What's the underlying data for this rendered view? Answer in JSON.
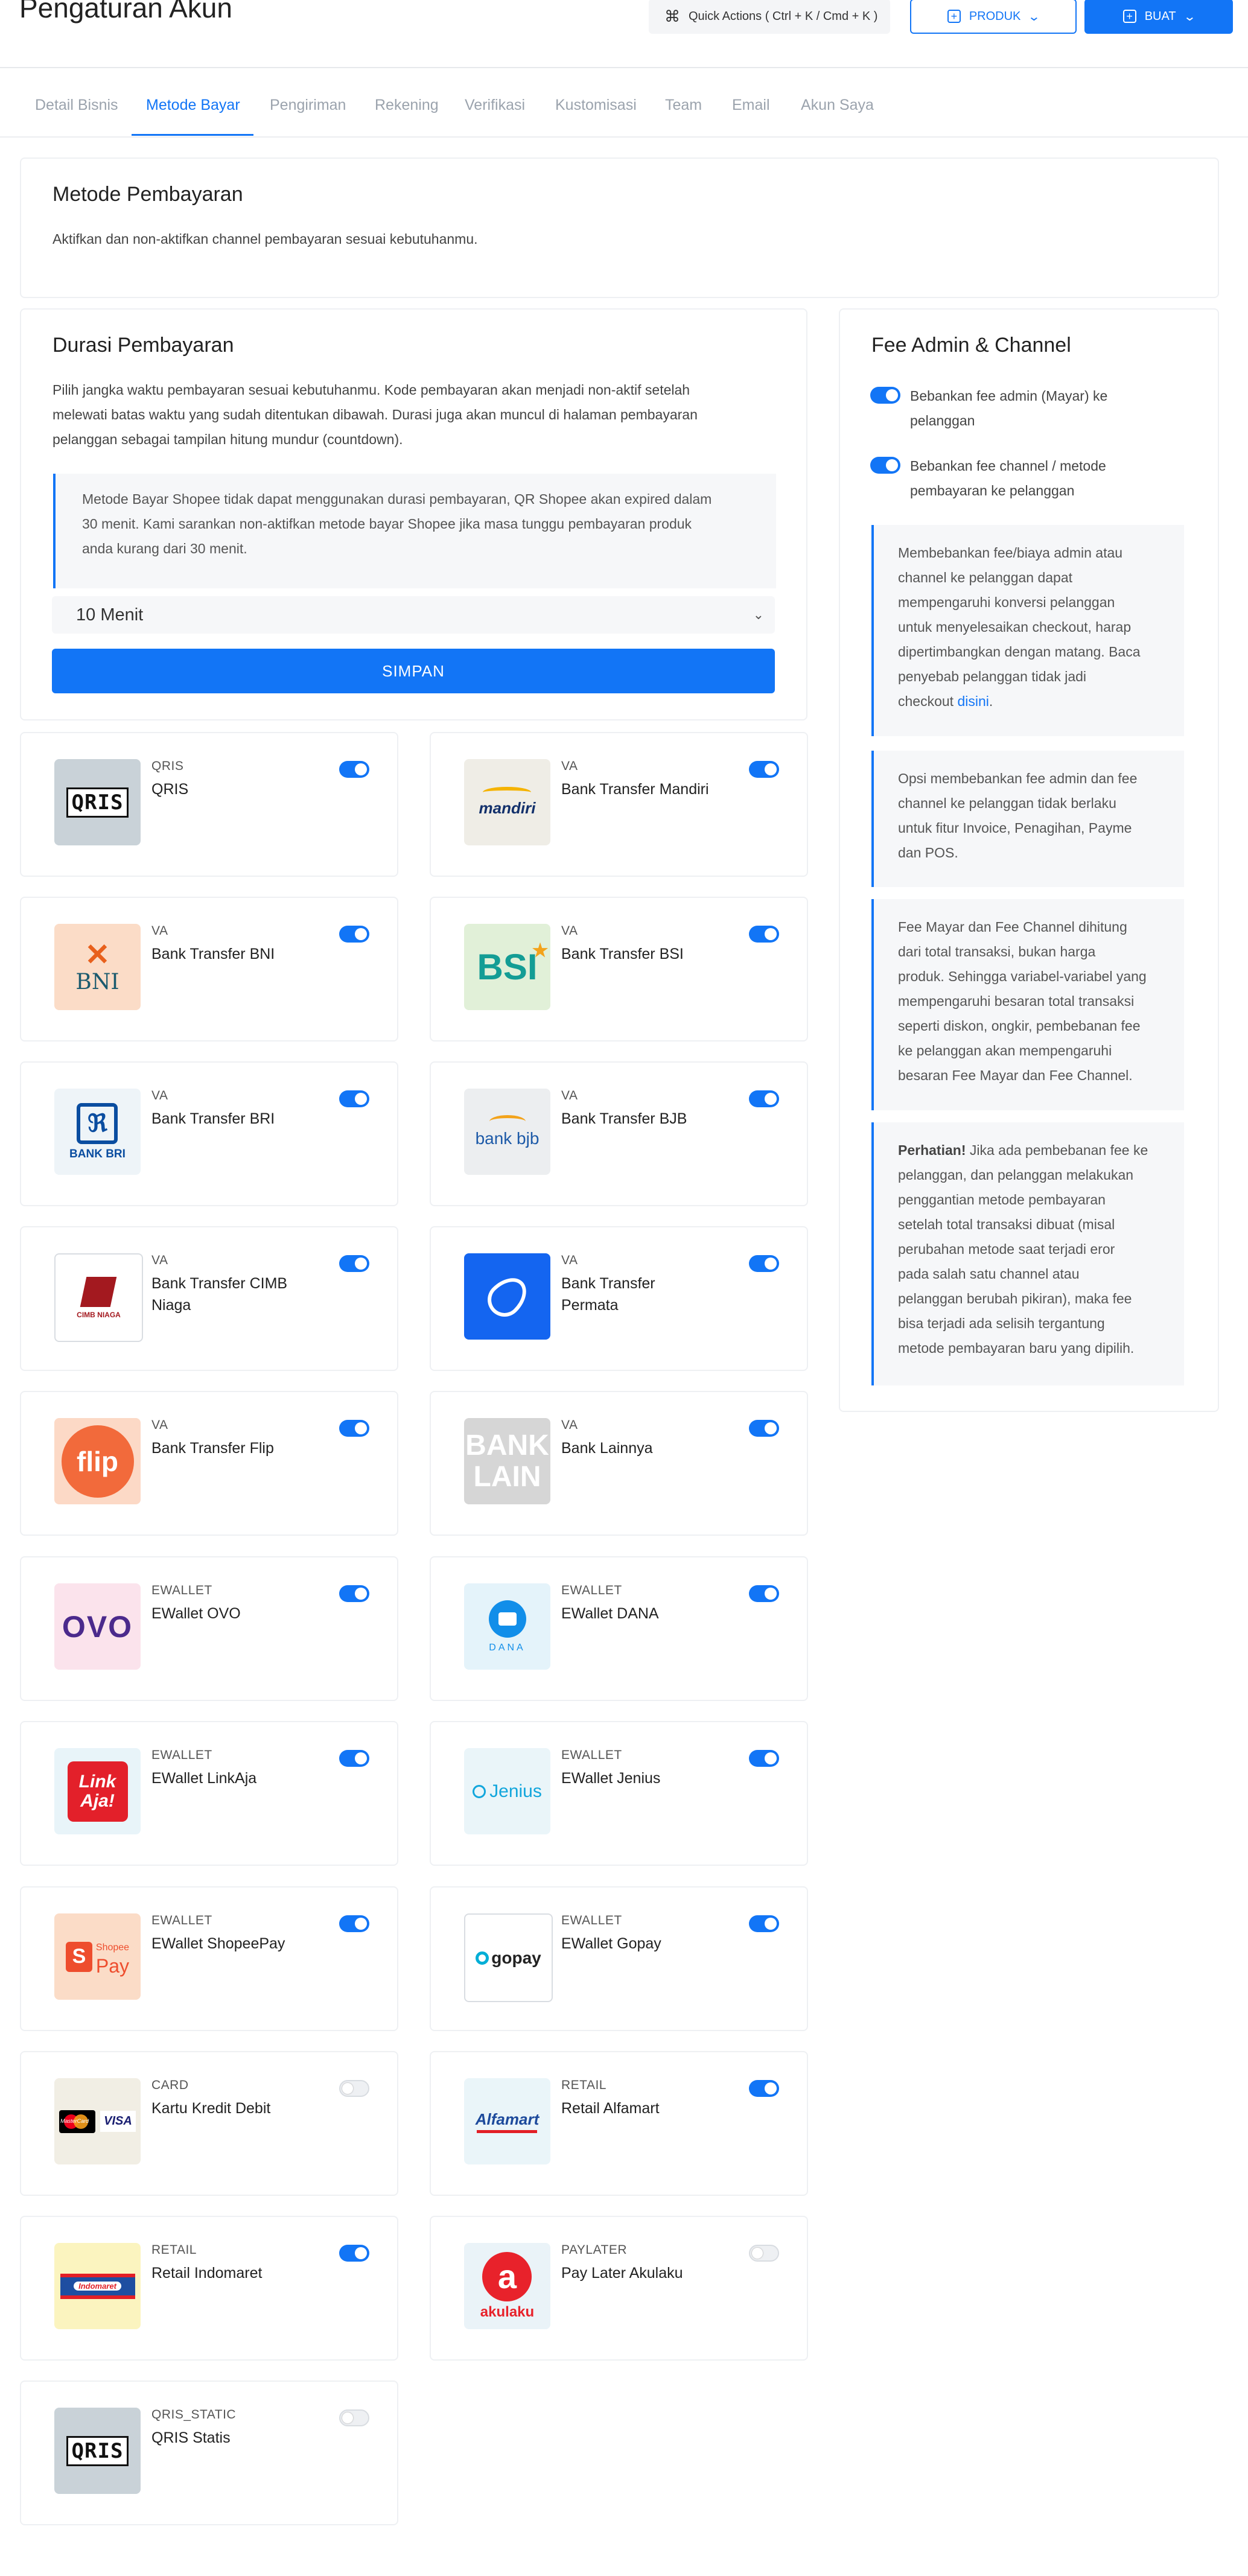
{
  "header": {
    "title": "Pengaturan Akun",
    "quick_actions": "Quick Actions ( Ctrl + K / Cmd + K )",
    "produk": "PRODUK",
    "buat": "BUAT"
  },
  "tabs": [
    {
      "label": "Detail Bisnis"
    },
    {
      "label": "Metode Bayar"
    },
    {
      "label": "Pengiriman"
    },
    {
      "label": "Rekening"
    },
    {
      "label": "Verifikasi"
    },
    {
      "label": "Kustomisasi"
    },
    {
      "label": "Team"
    },
    {
      "label": "Email"
    },
    {
      "label": "Akun Saya"
    }
  ],
  "metode": {
    "title": "Metode Pembayaran",
    "desc": "Aktifkan dan non-aktifkan channel pembayaran sesuai kebutuhanmu."
  },
  "durasi": {
    "title": "Durasi Pembayaran",
    "desc_lines": [
      "Pilih jangka waktu pembayaran sesuai kebutuhanmu. Kode pembayaran akan menjadi non-aktif setelah",
      "melewati batas waktu yang sudah ditentukan dibawah. Durasi juga akan muncul di halaman pembayaran",
      "pelanggan sebagai tampilan hitung mundur (countdown)."
    ],
    "note_lines": [
      "Metode Bayar Shopee tidak dapat menggunakan durasi pembayaran, QR Shopee akan expired dalam",
      "30 menit. Kami sarankan non-aktifkan metode bayar Shopee jika masa tunggu pembayaran produk",
      "anda kurang dari 30 menit."
    ],
    "selected": "10 Menit",
    "save": "SIMPAN"
  },
  "fee": {
    "title": "Fee Admin & Channel",
    "toggle1": [
      "Bebankan fee admin (Mayar) ke",
      "pelanggan"
    ],
    "toggle2": [
      "Bebankan fee channel / metode",
      "pembayaran ke pelanggan"
    ],
    "note1": [
      "Membebankan fee/biaya admin atau",
      "channel ke pelanggan dapat",
      "mempengaruhi konversi pelanggan",
      "untuk menyelesaikan checkout, harap",
      "dipertimbangkan dengan matang. Baca",
      "penyebab pelanggan tidak jadi"
    ],
    "note1_last": "checkout ",
    "note1_link": "disini",
    "note1_end": ".",
    "note2": [
      "Opsi membebankan fee admin dan fee",
      "channel ke pelanggan tidak berlaku",
      "untuk fitur Invoice, Penagihan, Payme",
      "dan POS."
    ],
    "note3": [
      "Fee Mayar dan Fee Channel dihitung",
      "dari total transaksi, bukan harga",
      "produk. Sehingga variabel-variabel yang",
      "mempengaruhi besaran total transaksi",
      "seperti diskon, ongkir, pembebanan fee",
      "ke pelanggan akan mempengaruhi",
      "besaran Fee Mayar dan Fee Channel."
    ],
    "note4_bold": "Perhatian!",
    "note4_first": " Jika ada pembebanan fee ke",
    "note4": [
      "pelanggan, dan pelanggan melakukan",
      "penggantian metode pembayaran",
      "setelah total transaksi dibuat (misal",
      "perubahan metode saat terjadi eror",
      "pada salah satu channel atau",
      "pelanggan berubah pikiran), maka fee",
      "bisa terjadi ada selisih tergantung",
      "metode pembayaran baru yang dipilih."
    ]
  },
  "methods": [
    {
      "type": "QRIS",
      "name": "QRIS",
      "on": true,
      "icon": "qris-logo",
      "bg": "#c9d2d8"
    },
    {
      "type": "VA",
      "name": "Bank Transfer Mandiri",
      "on": true,
      "icon": "mandiri-logo",
      "bg": "#efede6"
    },
    {
      "type": "VA",
      "name": "Bank Transfer BNI",
      "on": true,
      "icon": "bni-logo",
      "bg": "#fbdcc7"
    },
    {
      "type": "VA",
      "name": "Bank Transfer BSI",
      "on": true,
      "icon": "bsi-logo",
      "bg": "#e1f0d8"
    },
    {
      "type": "VA",
      "name": "Bank Transfer BRI",
      "on": true,
      "icon": "bri-logo",
      "bg": "#eef4f8"
    },
    {
      "type": "VA",
      "name": "Bank Transfer BJB",
      "on": true,
      "icon": "bjb-logo",
      "bg": "#eceef0"
    },
    {
      "type": "VA",
      "name": "Bank Transfer CIMB Niaga",
      "on": true,
      "icon": "cimb-niaga-logo",
      "bg": "#ffffff"
    },
    {
      "type": "VA",
      "name": "Bank Transfer Permata",
      "on": true,
      "icon": "permata-logo",
      "bg": "#1465f0"
    },
    {
      "type": "VA",
      "name": "Bank Transfer Flip",
      "on": true,
      "icon": "flip-logo",
      "bg": "#fcd9c6"
    },
    {
      "type": "VA",
      "name": "Bank Lainnya",
      "on": true,
      "icon": "bank-lain-logo",
      "bg": "#d6d6d6"
    },
    {
      "type": "EWALLET",
      "name": "EWallet OVO",
      "on": true,
      "icon": "ovo-logo",
      "bg": "#fbe3ec"
    },
    {
      "type": "EWALLET",
      "name": "EWallet DANA",
      "on": true,
      "icon": "dana-logo",
      "bg": "#e4f3fa"
    },
    {
      "type": "EWALLET",
      "name": "EWallet LinkAja",
      "on": true,
      "icon": "linkaja-logo",
      "bg": "#e8f4f9"
    },
    {
      "type": "EWALLET",
      "name": "EWallet Jenius",
      "on": true,
      "icon": "jenius-logo",
      "bg": "#eaf5f9"
    },
    {
      "type": "EWALLET",
      "name": "EWallet ShopeePay",
      "on": true,
      "icon": "shopeepay-logo",
      "bg": "#fbdcc7"
    },
    {
      "type": "EWALLET",
      "name": "EWallet Gopay",
      "on": true,
      "icon": "gopay-logo",
      "bg": "#ffffff"
    },
    {
      "type": "CARD",
      "name": "Kartu Kredit Debit",
      "on": false,
      "icon": "card-logo",
      "bg": "#f1eee4"
    },
    {
      "type": "RETAIL",
      "name": "Retail Alfamart",
      "on": true,
      "icon": "alfamart-logo",
      "bg": "#eaf5f9"
    },
    {
      "type": "RETAIL",
      "name": "Retail Indomaret",
      "on": true,
      "icon": "indomaret-logo",
      "bg": "#fbf4bf"
    },
    {
      "type": "PAYLATER",
      "name": "Pay Later Akulaku",
      "on": false,
      "icon": "akulaku-logo",
      "bg": "#eaf3f8"
    },
    {
      "type": "QRIS_STATIC",
      "name": "QRIS Statis",
      "on": false,
      "icon": "qris-static-logo",
      "bg": "#c9d2d8"
    }
  ],
  "logo_text": {
    "qris": "QRIS",
    "mandiri": "mandiri",
    "bni": "BNI",
    "bsi": "BSI",
    "bri": "BANK BRI",
    "bjb": "bank bjb",
    "cimb": "CIMB NIAGA",
    "flip": "flip",
    "bank_lain_1": "BANK",
    "bank_lain_2": "LAIN",
    "ovo": "OVO",
    "dana": "DANA",
    "linkaja_1": "Link",
    "linkaja_2": "Aja!",
    "jenius": "Jenius",
    "shopee_1": "Shopee",
    "shopee_2": "Pay",
    "gopay": "gopay",
    "mastercard": "MasterCard",
    "visa": "VISA",
    "alfamart": "Alfamart",
    "indomaret": "Indomaret",
    "akulaku": "akulaku"
  }
}
